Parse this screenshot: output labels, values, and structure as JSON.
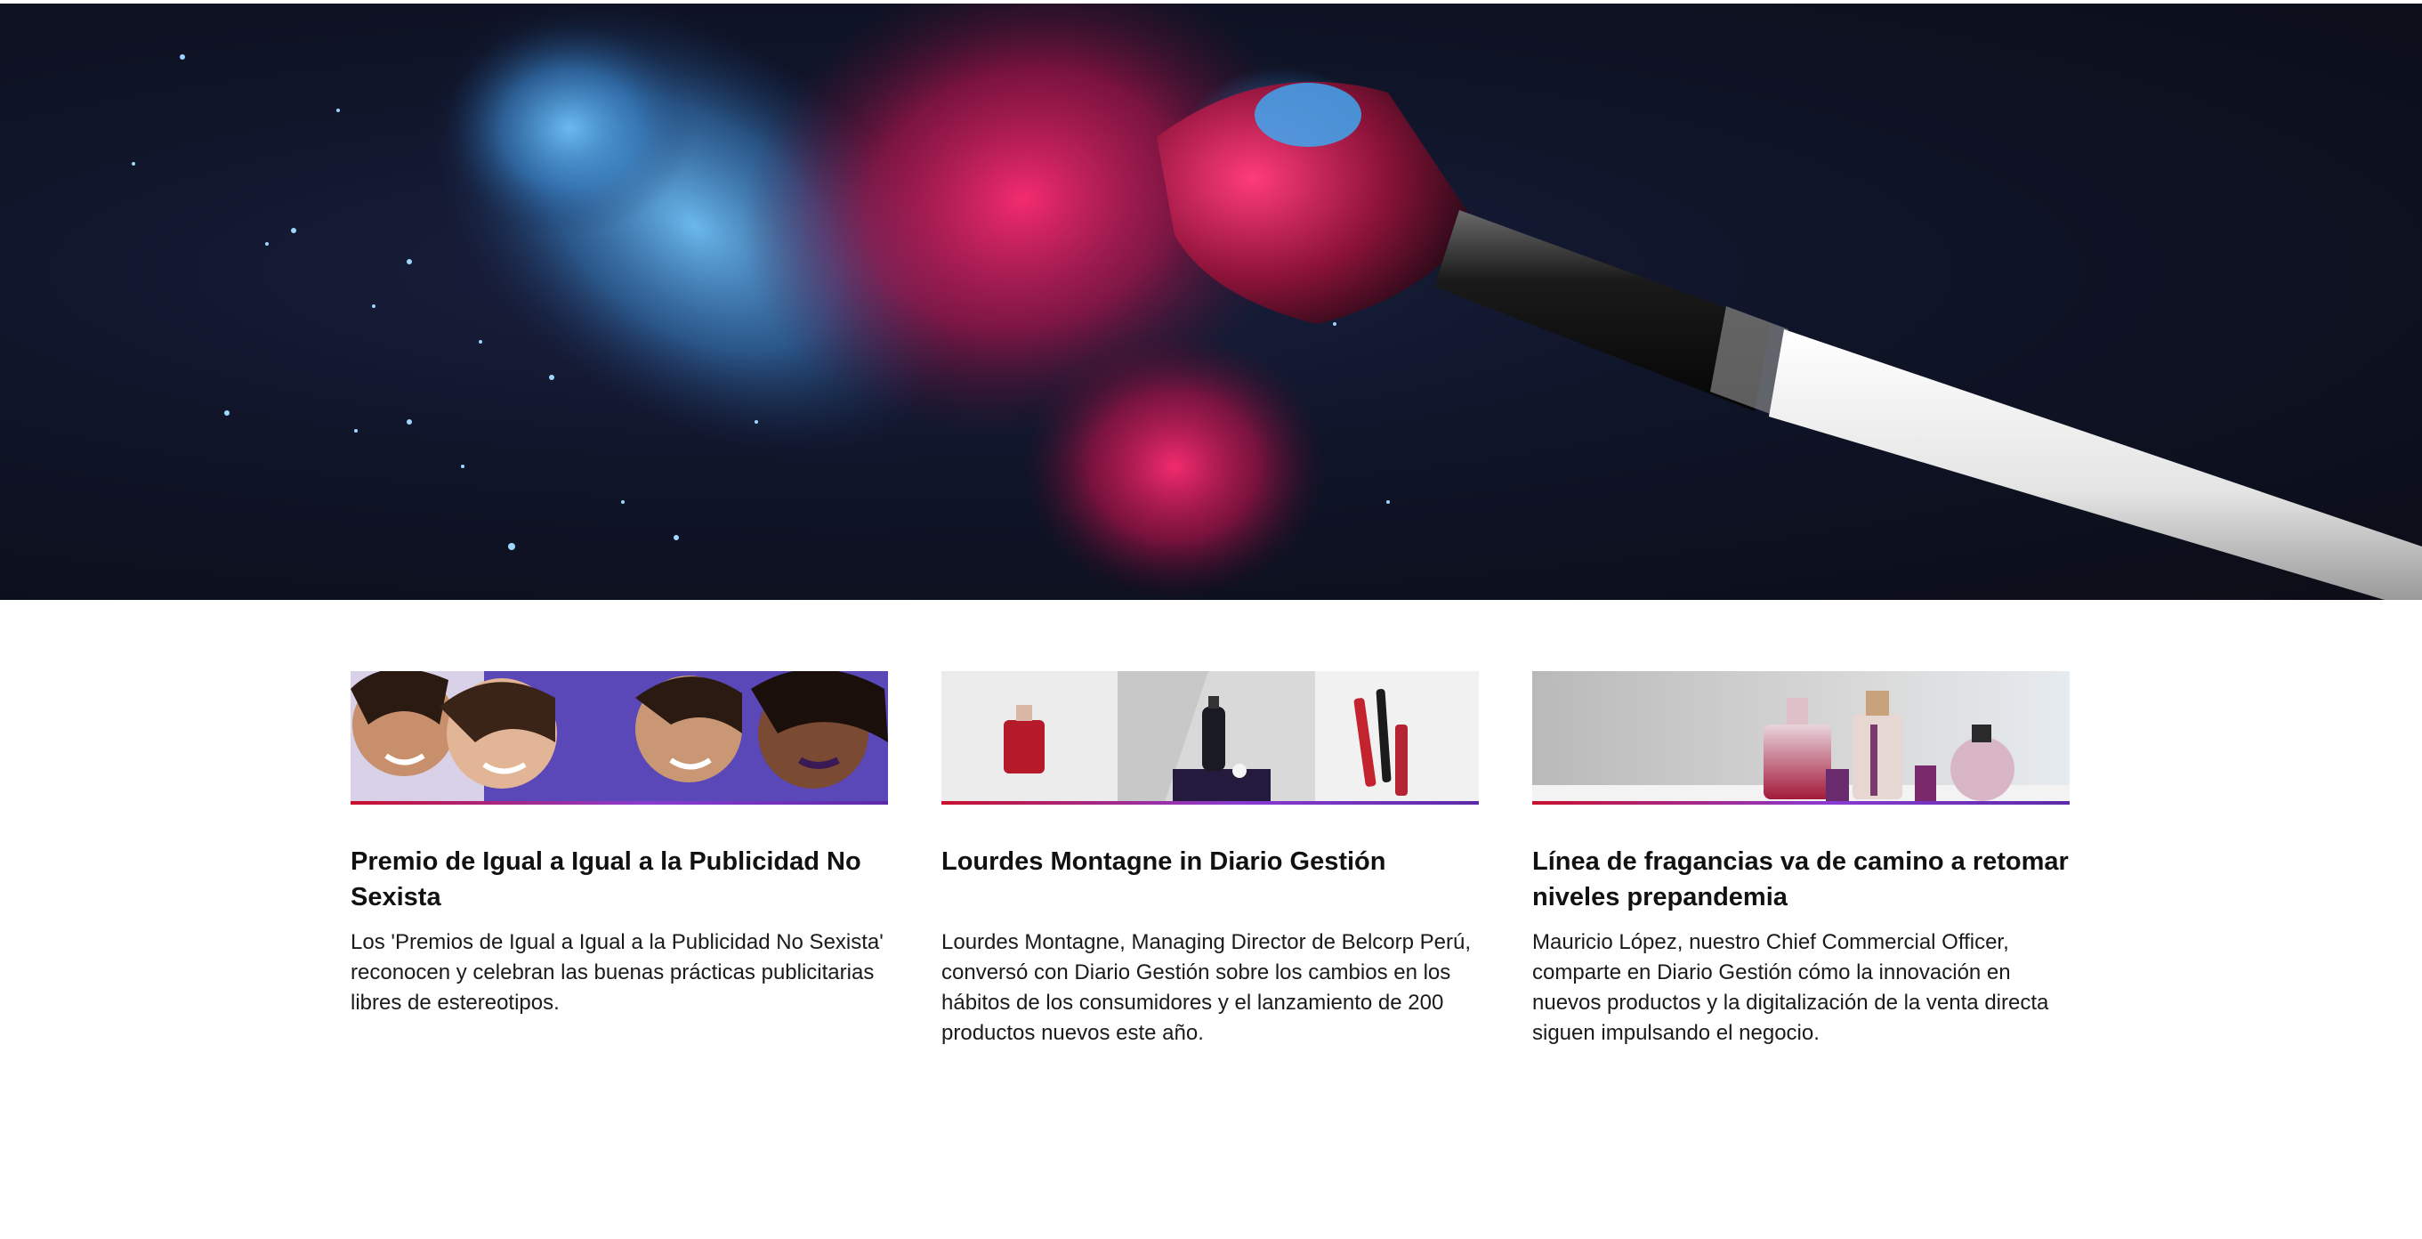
{
  "hero": {
    "image": "makeup-brush-colored-powder-burst",
    "colors": {
      "background": "#0f1428",
      "powder_blue": "#4aa3e6",
      "powder_magenta": "#e0185a",
      "brush_handle": "#f2f2f2",
      "brush_ferrule": "#121212"
    }
  },
  "accent_gradient": [
    "#c8102e",
    "#8a3bd1",
    "#5b2aa8"
  ],
  "articles": [
    {
      "image": "smiling-women-purple-background",
      "title": "Premio de Igual a Igual a la Publicidad No Sexista",
      "text": "Los 'Premios de Igual a Igual a la Publicidad No Sexista' reconocen y celebran las buenas prácticas publicitarias libres de estereotipos."
    },
    {
      "image": "perfume-and-lipstick-products",
      "title": "Lourdes Montagne in Diario Gestión",
      "text": "Lourdes Montagne, Managing Director de Belcorp Perú, conversó con Diario Gestión sobre los cambios en los hábitos de los consumidores y el lanzamiento de 200 productos nuevos este año."
    },
    {
      "image": "fragrance-bottles-lineup",
      "title": "Línea de fragancias va de camino a retomar niveles prepandemia",
      "text": "Mauricio López, nuestro Chief Commercial Officer, comparte en Diario Gestión cómo la innovación en nuevos productos y la digitalización de la venta directa siguen impulsando el negocio."
    }
  ]
}
